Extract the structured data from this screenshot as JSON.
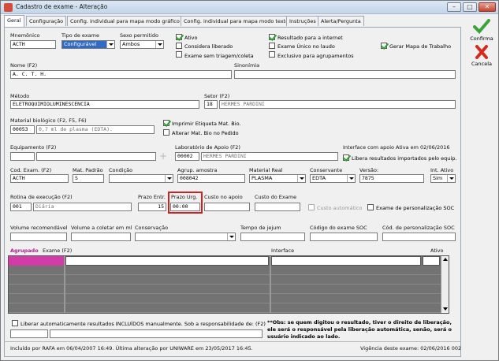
{
  "window": {
    "title": "Cadastro de exame - Alteração",
    "min_label": "–",
    "max_label": "□",
    "close_label": "✕"
  },
  "tabs": [
    {
      "label": "Geral"
    },
    {
      "label": "Configuração"
    },
    {
      "label": "Config. individual para mapa modo gráfico"
    },
    {
      "label": "Config. individual para mapa modo texto"
    },
    {
      "label": "Instruções"
    },
    {
      "label": "Alerta/Pergunta"
    }
  ],
  "sidebar": {
    "confirm_label": "Confirma",
    "cancel_label": "Cancela",
    "confirm_icon": "check-icon",
    "cancel_icon": "x-icon"
  },
  "form": {
    "mnemonico_label": "Mnemônico",
    "mnemonico_value": "ACTH",
    "tipo_label": "Tipo de exame",
    "tipo_value": "Configurável",
    "sexo_label": "Sexo permitido",
    "sexo_value": "Ambos",
    "ativo_label": "Ativo",
    "considera_label": "Considera liberado",
    "sem_triagem_label": "Exame sem triagem/coleta",
    "resultado_internet_label": "Resultado para a internet",
    "exame_unico_label": "Exame Único no laudo",
    "exclusivo_label": "Exclusivo para agrupamentos",
    "gerar_mapa_label": "Gerar Mapa de Trabalho",
    "nome_label": "Nome (F2)",
    "nome_value": "A. C. T. H.",
    "sinonimia_label": "Sinonímia",
    "metodo_label": "Método",
    "metodo_value": "ELETROQUIMIOLUMINESCENCIA",
    "setor_label": "Setor (F2)",
    "setor_code": "18",
    "setor_value": "HERMES PARDINI",
    "material_label": "Material biológico (F2, F5, F6)",
    "material_code": "00053",
    "material_value": "0,7 ml de plasma (EDTA).",
    "imprimir_label": "Imprimir Etiqueta Mat. Bio.",
    "alterar_label": "Alterar Mat. Bio no Pedido",
    "equipamento_label": "Equipamento (F2)",
    "laboratorio_label": "Laboratório de Apoio (F2)",
    "laboratorio_code": "00002",
    "laboratorio_value": "HERMES PARDINI",
    "interface_info": "Interface com apoio Ativa em 02/06/2016",
    "libera_label": "Libera resultados importados pelo equip.",
    "cod_exame_label": "Cod. Exam. (F2)",
    "cod_exame_value": "ACTH",
    "mat_padrao_label": "Mat. Padrão",
    "mat_padrao_value": "S",
    "condicao_label": "Condição",
    "agrup_label": "Agrup. amostra",
    "agrup_value": "008042",
    "material_real_label": "Material Real",
    "material_real_value": "PLASMA",
    "conservante_label": "Conservante",
    "conservante_value": "EDTA",
    "versao_label": "Versão:",
    "versao_value": "7875",
    "int_ativo_label": "Int. Ativo",
    "int_ativo_value": "Sim",
    "rotina_label": "Rotina de execução (F2)",
    "rotina_code": "001",
    "rotina_value": "Diária",
    "prazo_entr_label": "Prazo Entr.",
    "prazo_entr_value": "15",
    "prazo_urg_label": "Prazo Urg.",
    "prazo_urg_value": "00:00",
    "custo_apoio_label": "Custo no apoio",
    "custo_exame_label": "Custo do Exame",
    "custo_auto_label": "Custo automático",
    "exame_personalizacao_label": "Exame de personalização SOC",
    "volume_rec_label": "Volume recomendável",
    "volume_coletar_label": "Volume a coletar em ml",
    "conservacao_label": "Conservação",
    "tempo_jejum_label": "Tempo de jejum",
    "codigo_soc_label": "Código do exame SOC",
    "cod_personalizacao_label": "Cód. de personalização SOC"
  },
  "grid": {
    "agrupado_label": "Agrupado",
    "exame_label": "Exame (F2)",
    "interface_label": "Interface",
    "ativo_label": "Ativo"
  },
  "footer": {
    "liberar_label": "Liberar automaticamente resultados INCLUÍDOS manualmente. Sob a responsabilidade de: (F2)",
    "obs_text": "**Obs: se quem digitou o resultado, tiver o direito de liberação, ele será o responsável pela liberação automática, senão, será o usuário indicado ao lado.",
    "status_left": "Incluído por RAFA em 06/04/2007 16:49. Última alteração por UNIWARE em 23/05/2017 16:45.",
    "status_right": "Vigência deste exame: 02/06/2016 002"
  },
  "colors": {
    "accent": "#2f6ac5",
    "highlight": "#d02020",
    "grid_bg": "#737373",
    "agrupado_color": "#c0299c"
  }
}
